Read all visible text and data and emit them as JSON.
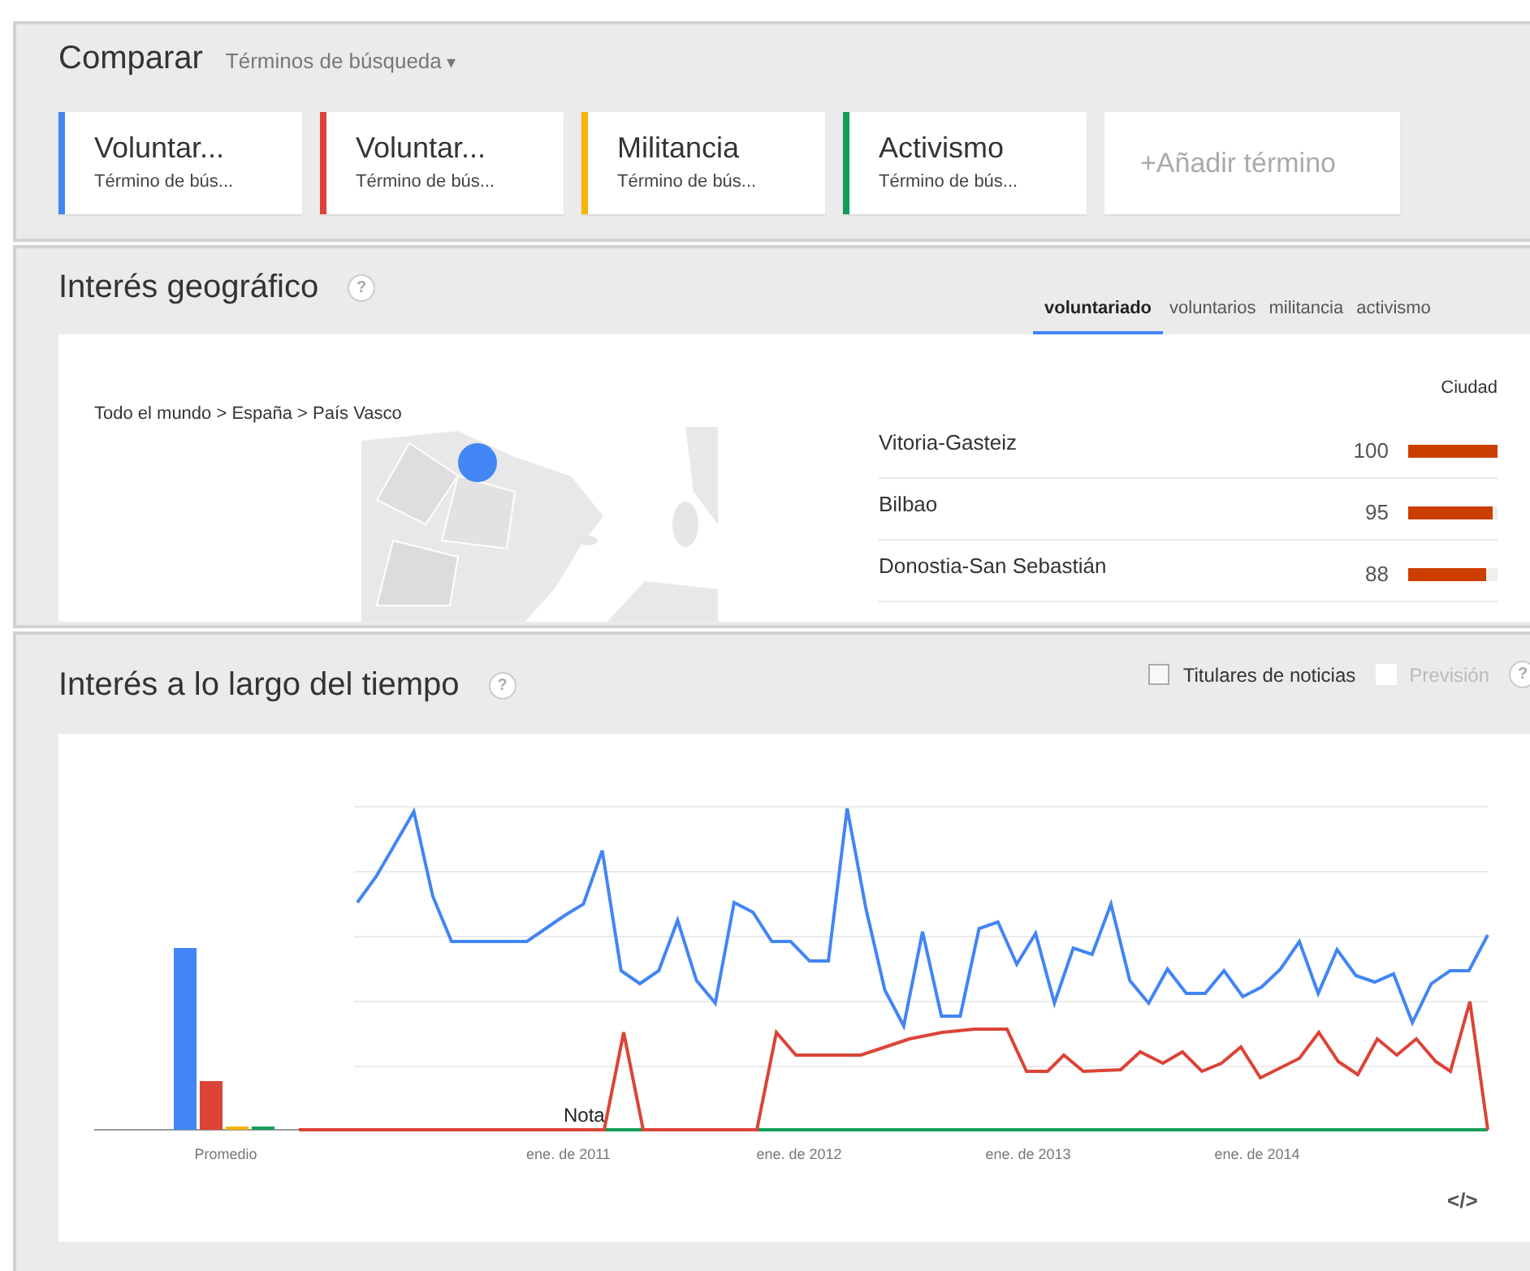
{
  "compare": {
    "title": "Comparar",
    "selector": "Términos de búsqueda",
    "selector_caret": "▾",
    "terms": [
      {
        "name": "Voluntar...",
        "subtitle": "Término de bús...",
        "color": "#4285f4"
      },
      {
        "name": "Voluntar...",
        "subtitle": "Término de bús...",
        "color": "#db4437"
      },
      {
        "name": "Militancia",
        "subtitle": "Término de bús...",
        "color": "#f4b400"
      },
      {
        "name": "Activismo",
        "subtitle": "Término de bús...",
        "color": "#0f9d58"
      }
    ],
    "add_term": "+Añadir término"
  },
  "geo": {
    "title": "Interés geográfico",
    "help": "?",
    "tabs": [
      {
        "label": "voluntariado",
        "selected": true
      },
      {
        "label": "voluntarios",
        "selected": false
      },
      {
        "label": "militancia",
        "selected": false
      },
      {
        "label": "activismo",
        "selected": false
      }
    ],
    "breadcrumb": "Todo el mundo > España > País Vasco",
    "column": "Ciudad",
    "rows": [
      {
        "name": "Vitoria-Gasteiz",
        "value": "100",
        "level": 1
      },
      {
        "name": "Bilbao",
        "value": "95",
        "level": 0.95
      },
      {
        "name": "Donostia-San Sebastián",
        "value": "88",
        "level": 0.88
      }
    ]
  },
  "time": {
    "title": "Interés a lo largo del tiempo",
    "help": "?",
    "options": [
      {
        "label": "Titulares de noticias",
        "checked": false,
        "disabled": false
      },
      {
        "label": "Previsión",
        "checked": false,
        "disabled": true
      }
    ],
    "options_help": "?",
    "average_label": "Promedio",
    "x_labels": [
      "ene. de 2011",
      "ene. de 2012",
      "ene. de 2013",
      "ene. de 2014"
    ],
    "note": "Nota",
    "embed": "</>"
  }
}
